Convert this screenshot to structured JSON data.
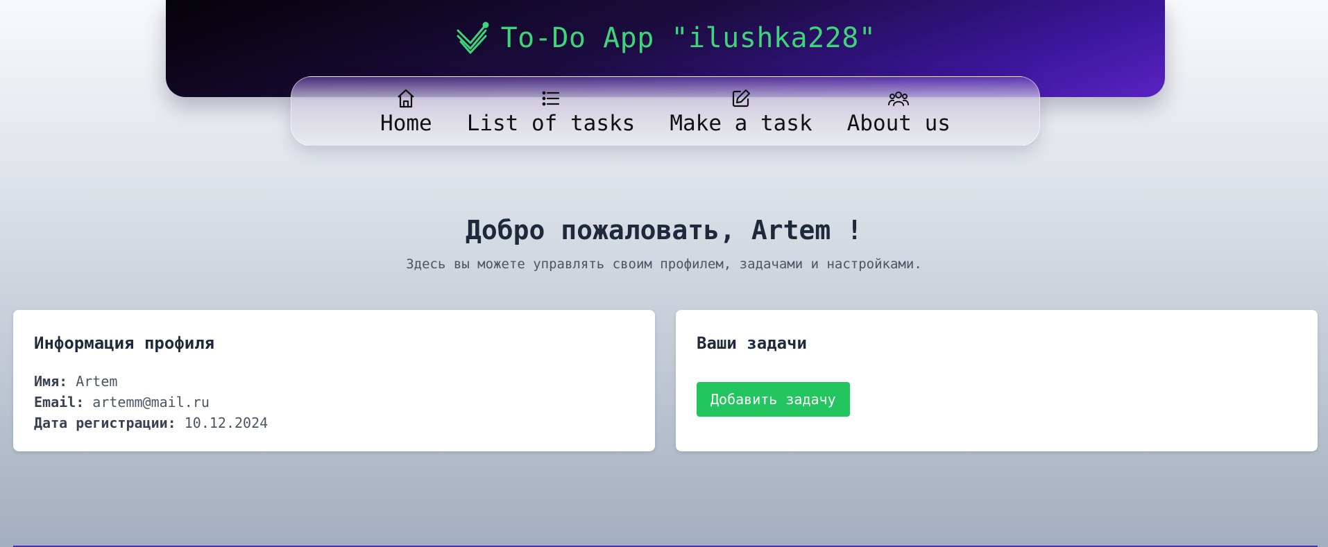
{
  "header": {
    "logo_icon": "checkmark-logo-icon",
    "title": "To-Do App \"ilushka228\"",
    "title_color": "#3fd37a"
  },
  "nav": {
    "items": [
      {
        "label": "Home",
        "icon": "home-icon"
      },
      {
        "label": "List of tasks",
        "icon": "list-icon"
      },
      {
        "label": "Make a task",
        "icon": "edit-icon"
      },
      {
        "label": "About us",
        "icon": "users-icon"
      }
    ]
  },
  "welcome": {
    "title": "Добро пожаловать, Artem !",
    "subtitle": "Здесь вы можете управлять своим профилем, задачами и настройками."
  },
  "profile": {
    "heading": "Информация профиля",
    "name_label": "Имя:",
    "name_value": "Artem",
    "email_label": "Email:",
    "email_value": "artemm@mail.ru",
    "date_label": "Дата регистрации:",
    "date_value": "10.12.2024"
  },
  "tasks": {
    "heading": "Ваши задачи",
    "add_button": "Добавить задачу",
    "button_color": "#22c55e"
  }
}
